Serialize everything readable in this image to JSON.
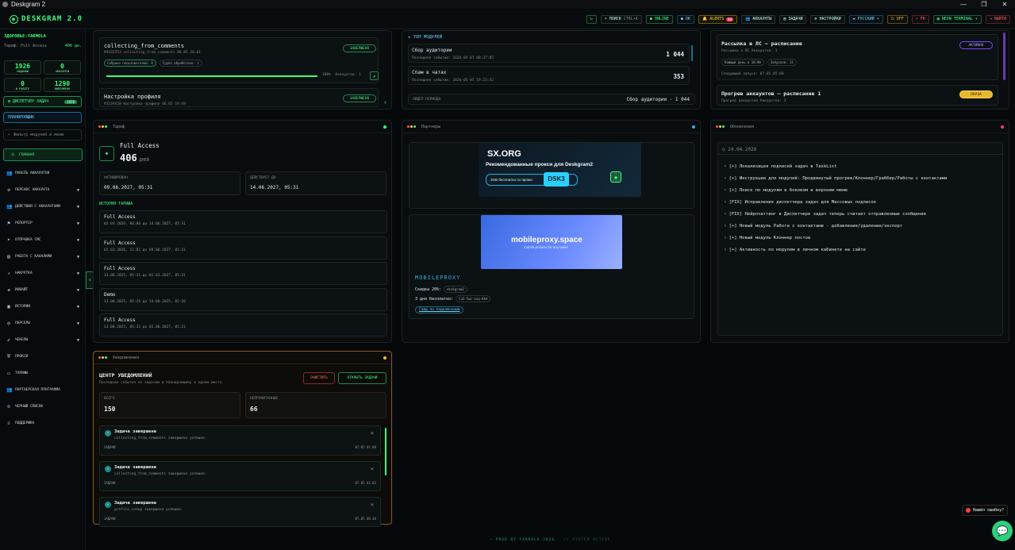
{
  "window": {
    "title": "Deskgram 2",
    "controls": [
      "—",
      "❐",
      "✕"
    ]
  },
  "topbar": {
    "logo": "DESKGRAM 2.0",
    "refresh_icon": "↻",
    "search_label": "ПОИСК",
    "search_shortcut": "CTRL+K",
    "online": "ONLINE",
    "status2": "OK",
    "alerts_label": "ALERTS",
    "alerts_count": "44",
    "accounts": "АККАУНТЫ",
    "tasks": "ЗАДАЧИ",
    "settings": "НАСТРОЙКИ",
    "language": "РУССКИЙ",
    "off": "OFF",
    "fr": "FR",
    "neon": "NEON TERMINAL",
    "logout": "ВЫЙТИ"
  },
  "sidebar": {
    "health": "ЗДОРОВЬЕ:YARMOLA",
    "tariff_label": "Тариф: Full Access",
    "tariff_days": "406 дн.",
    "stats": [
      {
        "value": "1926",
        "label": "ЗАДАНИЙ"
      },
      {
        "value": "0",
        "label": "АККАУНТЫ"
      },
      {
        "value": "0",
        "label": "В РАБОТЕ"
      },
      {
        "value": "1290",
        "label": "ВЫПОЛНЕНО"
      }
    ],
    "dispatcher": "ДИСПЕТЧЕР ЗАДАЧ",
    "dispatcher_count": "1926",
    "scheduler": "ПЛАНИРОВЩИК",
    "filter_placeholder": "Фильтр модулей в меню",
    "items": [
      {
        "label": "ГЛАВНАЯ",
        "icon": "home-icon",
        "glyph": "⌂"
      },
      {
        "label": "ПАНЕЛЬ АККАУНТОВ",
        "icon": "users-icon",
        "glyph": "👥"
      },
      {
        "label": "ПЕРЕНОС АККАУНТА",
        "icon": "transfer-icon",
        "glyph": "⇄",
        "expand": true
      },
      {
        "label": "ДЕЙСТВИЯ С АККАУНТАМИ",
        "icon": "users-icon",
        "glyph": "👥",
        "expand": true
      },
      {
        "label": "РЕПОРТЕР",
        "icon": "flag-icon",
        "glyph": "⚑",
        "expand": true
      },
      {
        "label": "ОТПРАВКА СМС",
        "icon": "send-icon",
        "glyph": "➤",
        "expand": true
      },
      {
        "label": "РАБОТА С КАНАЛАМИ",
        "icon": "channel-icon",
        "glyph": "▤",
        "expand": true
      },
      {
        "label": "НАКРУТКА",
        "icon": "chart-icon",
        "glyph": "↗",
        "expand": true
      },
      {
        "label": "ИНВАЙТ",
        "icon": "invite-icon",
        "glyph": "✚",
        "expand": true
      },
      {
        "label": "ИСТОРИИ",
        "icon": "stories-icon",
        "glyph": "▣",
        "expand": true
      },
      {
        "label": "ПАРСЕРЫ",
        "icon": "parser-icon",
        "glyph": "◎",
        "expand": true
      },
      {
        "label": "ЧЕКЕРЫ",
        "icon": "check-icon",
        "glyph": "✔",
        "expand": true
      },
      {
        "label": "ПРОКСИ",
        "icon": "shield-icon",
        "glyph": "⛨"
      },
      {
        "label": "ТАРИФЫ",
        "icon": "card-icon",
        "glyph": "▭"
      },
      {
        "label": "ПАРТНЕРСКАЯ ПРОГРАММА",
        "icon": "partner-icon",
        "glyph": "👥"
      },
      {
        "label": "ЧЕРНЫЙ СПИСОК",
        "icon": "block-icon",
        "glyph": "⊘"
      },
      {
        "label": "ПОДДЕРЖКА",
        "icon": "support-icon",
        "glyph": "☏"
      }
    ]
  },
  "tasks_panel": {
    "task1": {
      "title": "collecting_from_comments",
      "meta": "#4432253  collecting_from_comments  06.05 20:01",
      "status": "ЗАВЕРШЕНО",
      "collected": "Собрано пользователей: 0",
      "groups": "Групп обработано: 1",
      "progress": "100%",
      "progress_value": 100,
      "accounts": "Аккаунтов: 1"
    },
    "task2": {
      "title": "Настройка профиля",
      "meta": "#3239428  Настройка профиля  06.05 19:49",
      "status": "ЗАВЕРШЕНО"
    }
  },
  "modules_panel": {
    "title": "ТОП МОДУЛЕЙ",
    "items": [
      {
        "name": "Сбор аудитории",
        "last": "Последнее событие: 2026-05-07 00:37:05",
        "value": "1 044"
      },
      {
        "name": "Спам в чатах",
        "last": "Последнее событие: 2026-05-05 19:23:42",
        "value": "353"
      }
    ],
    "leader_label": "ЛИДЕР ПЕРИОДА",
    "leader_value": "Сбор аудитории · 1 044"
  },
  "schedule_panel": {
    "item1": {
      "title": "Рассылка в ЛС — расписание",
      "sub": "Рассылка в ЛС  Аккаунтов: 1",
      "pill1": "Каждый день в 10:00",
      "pill2": "Запусков: 11",
      "next": "Следующий запуск: 07.05 05:00",
      "status": "АКТИВНО"
    },
    "item2": {
      "title": "Прогрев аккаунтов — расписание 1",
      "sub": "Прогрев аккаунтов  Аккаунтов: 3",
      "status": "ПАУЗА"
    }
  },
  "tariff_panel": {
    "header": "Тариф",
    "name": "Full Access",
    "days": "406",
    "days_unit": "ДНЕЙ",
    "activated_label": "АКТИВИРОВАН",
    "activated": "09.06.2027, 05:31",
    "valid_label": "ДЕЙСТВУЕТ ДО",
    "valid": "14.06.2027, 05:31",
    "history_title": "ИСТОРИЯ ТАРИФА",
    "history": [
      {
        "name": "Full Access",
        "dates": "02.03.2026, 06:06 до 14.06.2027, 05:31"
      },
      {
        "name": "Full Access",
        "dates": "02.03.2026, 11:01 до 09.06.2027, 05:31"
      },
      {
        "name": "Full Access",
        "dates": "13.08.2025, 05:31 до 02.03.2027, 05:31"
      },
      {
        "name": "Demo",
        "dates": "13.08.2025, 05:26 до 14.08.2025, 05:26"
      },
      {
        "name": "Full Access",
        "dates": "13.08.2025, 05:21 до 02.06.2027, 05:21"
      }
    ]
  },
  "partners_panel": {
    "header": "Партнеры",
    "banner1_title": "SX.ORG",
    "banner1_text": "Рекомендованные прокси для Deskgram2",
    "banner1_promo": "3GB бесплатно по промо:",
    "banner1_code": "DSK3",
    "banner2_title": "mobileproxy.space",
    "banner2_sub": "mobile proxies for any tasks",
    "brand": "MOBILEPROXY",
    "discount": "Скидка 20%:",
    "discount_code": "deskgram2",
    "trial": "3 дня бесплатно:",
    "trial_code": "CuS-5wc-Lnq-KkA",
    "guide": "Гайд по подключению"
  },
  "updates_panel": {
    "header": "Обновления",
    "date": "24.04.2026",
    "items": [
      "[+] Локализация подписей задач в TaskList",
      "[+] Инструкции для модулей: Продвинутый прогрев/Клоннер/Граббер/Работы с контактами",
      "[+] Поиск по модулям в боковом и верхнем меню",
      "[FIX] Исправление диспетчера задач для Массовых подписок",
      "[FIX] Нейрочаттинг в Диспетчере задач теперь считает отправленные сообщения",
      "[+] Новый модуль Работа с контактами - добавление/удаление/экспорт",
      "[+] Новый модуль Клоннер постов",
      "[+] Активность по модулям в личном кабинете на сайте"
    ]
  },
  "notifications_panel": {
    "header": "Уведомления",
    "title": "ЦЕНТР УВЕДОМЛЕНИЙ",
    "subtitle": "Последние события по задачам и планировщику в одном месте.",
    "clear": "ОЧИСТИТЬ",
    "open": "ОТКРЫТЬ ЗАДАЧИ",
    "total_label": "ВСЕГО",
    "total": "150",
    "unread_label": "НЕПРОЧИТАННЫЕ",
    "unread": "66",
    "items": [
      {
        "title": "Задача завершена",
        "desc": "collecting_from_comments завершена успешно.",
        "tag": "ЗАДАЧИ",
        "time": "07.05 01:00"
      },
      {
        "title": "Задача завершена",
        "desc": "collecting_from_comments завершена успешно.",
        "tag": "ЗАДАЧИ",
        "time": "07.05 01:02"
      },
      {
        "title": "Задача завершена",
        "desc": "profile_setup завершена успешно.",
        "tag": "ЗАДАЧИ",
        "time": "07.05 00:40"
      }
    ]
  },
  "footer": {
    "text": "— PROD BY YARMOLA 2026",
    "status": "// SYSTEM ACTIVE"
  },
  "help": {
    "label": "Нашёл ошибку?"
  },
  "colors": {
    "accent": "#39ff7a",
    "bg": "#06090c",
    "warn": "#ffd24a",
    "danger": "#ff5a5a"
  }
}
